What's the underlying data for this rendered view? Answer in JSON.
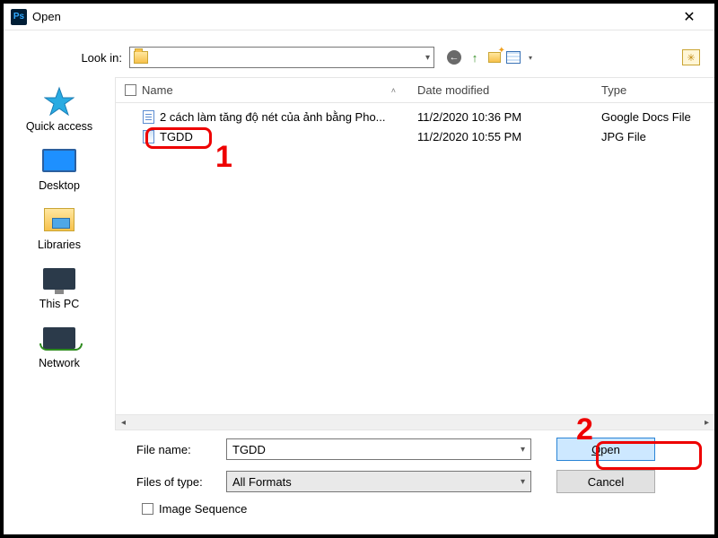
{
  "window": {
    "title": "Open",
    "close_glyph": "✕"
  },
  "lookin": {
    "label": "Look in:",
    "value": ""
  },
  "toolbar_icons": {
    "back": "←",
    "up": "↑",
    "new": "",
    "view": "",
    "drop": "▾",
    "extra": "✳"
  },
  "places": {
    "quickaccess": "Quick access",
    "desktop": "Desktop",
    "libraries": "Libraries",
    "thispc": "This PC",
    "network": "Network"
  },
  "columns": {
    "name": "Name",
    "date": "Date modified",
    "type": "Type",
    "sort_glyph": "˄"
  },
  "files": [
    {
      "icon": "doc",
      "name": "2 cách làm tăng độ nét của ảnh bằng Pho...",
      "date": "11/2/2020 10:36 PM",
      "type": "Google Docs File"
    },
    {
      "icon": "img",
      "name": "TGDD",
      "date": "11/2/2020 10:55 PM",
      "type": "JPG File"
    }
  ],
  "filename": {
    "label": "File name:",
    "value": "TGDD"
  },
  "filetype": {
    "label": "Files of type:",
    "value": "All Formats"
  },
  "buttons": {
    "open_pre": "O",
    "open_rest": "pen",
    "cancel": "Cancel"
  },
  "sequence": {
    "label": "Image Sequence"
  },
  "annotations": {
    "one": "1",
    "two": "2"
  }
}
